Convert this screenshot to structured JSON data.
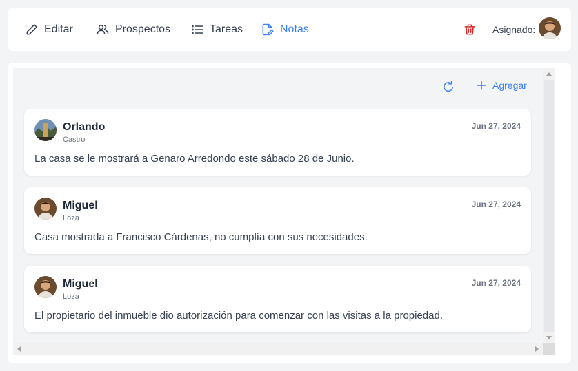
{
  "tabs": {
    "edit": "Editar",
    "prospects": "Prospectos",
    "tasks": "Tareas",
    "notes": "Notas"
  },
  "assigned_label": "Asignado:",
  "add_label": "Agregar",
  "colors": {
    "accent": "#3b82f6",
    "danger": "#dc2626"
  },
  "notes": [
    {
      "first_name": "Orlando",
      "last_name": "Castro",
      "date": "Jun 27, 2024",
      "text": "La casa se le mostrará a Genaro Arredondo este sábado 28 de Junio."
    },
    {
      "first_name": "Miguel",
      "last_name": "Loza",
      "date": "Jun 27, 2024",
      "text": "Casa mostrada a Francisco Cárdenas, no cumplía con sus necesidades."
    },
    {
      "first_name": "Miguel",
      "last_name": "Loza",
      "date": "Jun 27, 2024",
      "text": "El propietario del inmueble dio autorización para comenzar con las visitas a la propiedad."
    }
  ]
}
